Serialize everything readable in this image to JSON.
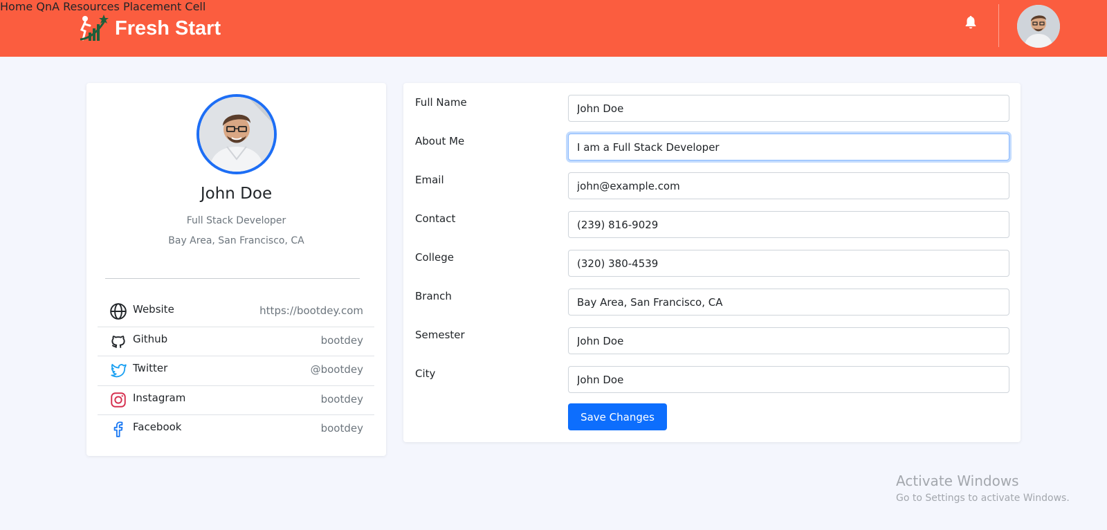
{
  "header": {
    "brand": "Fresh Start",
    "nav": [
      "Home",
      "QnA",
      "Resources",
      "Placement Cell"
    ],
    "accent_color": "#fb5d3f"
  },
  "profile": {
    "name": "John Doe",
    "role": "Full Stack Developer",
    "location": "Bay Area, San Francisco, CA",
    "links": [
      {
        "icon": "globe-icon",
        "label": "Website",
        "value": "https://bootdey.com"
      },
      {
        "icon": "github-icon",
        "label": "Github",
        "value": "bootdey"
      },
      {
        "icon": "twitter-icon",
        "label": "Twitter",
        "value": "@bootdey"
      },
      {
        "icon": "instagram-icon",
        "label": "Instagram",
        "value": "bootdey"
      },
      {
        "icon": "facebook-icon",
        "label": "Facebook",
        "value": "bootdey"
      }
    ]
  },
  "form": {
    "fields": [
      {
        "label": "Full Name",
        "value": "John Doe"
      },
      {
        "label": "About Me",
        "value": "I am a Full Stack Developer"
      },
      {
        "label": "Email",
        "value": "john@example.com"
      },
      {
        "label": "Contact",
        "value": "(239) 816-9029"
      },
      {
        "label": "College",
        "value": "(320) 380-4539"
      },
      {
        "label": "Branch",
        "value": "Bay Area, San Francisco, CA"
      },
      {
        "label": "Semester",
        "value": "John Doe"
      },
      {
        "label": "City",
        "value": "John Doe"
      }
    ],
    "save_label": "Save Changes"
  },
  "watermark": {
    "line1": "Activate Windows",
    "line2": "Go to Settings to activate Windows."
  }
}
